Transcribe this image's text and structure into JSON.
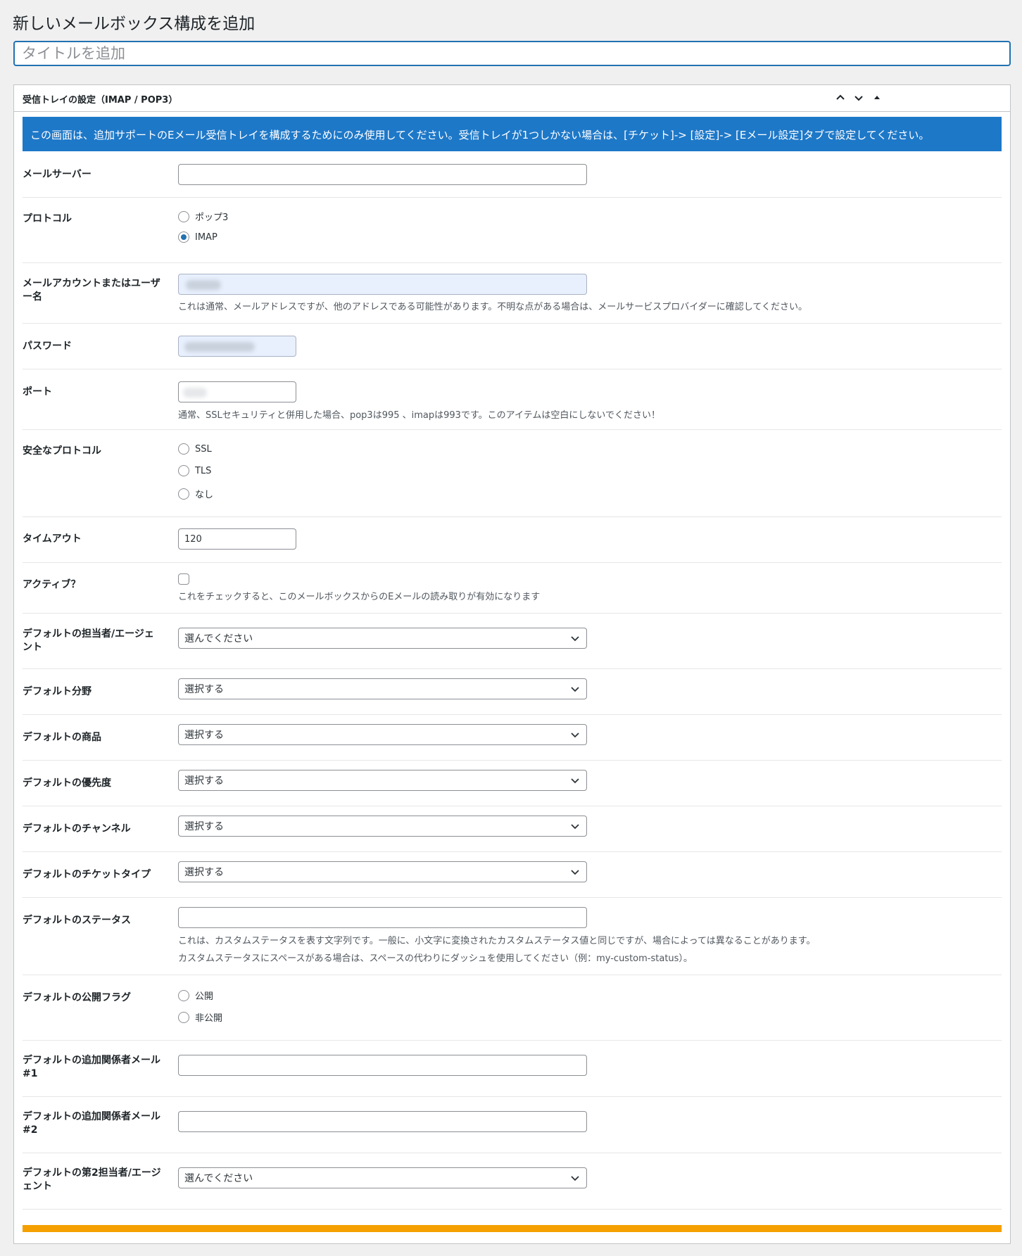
{
  "page": {
    "title": "新しいメールボックス構成を追加",
    "title_input_placeholder": "タイトルを追加"
  },
  "postbox": {
    "title": "受信トレイの設定（IMAP / POP3）",
    "notice": "この画面は、追加サポートのEメール受信トレイを構成するためにのみ使用してください。受信トレイが1つしかない場合は、[チケット]-> [設定]-> [Eメール設定]タブで設定してください。"
  },
  "fields": {
    "mail_server": {
      "label": "メールサーバー",
      "value": ""
    },
    "protocol": {
      "label": "プロトコル",
      "options": [
        "ポップ3",
        "IMAP"
      ],
      "selected": "IMAP"
    },
    "account": {
      "label": "メールアカウントまたはユーザー名",
      "description": "これは通常、メールアドレスですが、他のアドレスである可能性があります。不明な点がある場合は、メールサービスプロバイダーに確認してください。"
    },
    "password": {
      "label": "パスワード"
    },
    "port": {
      "label": "ポート",
      "description": "通常、SSLセキュリティと併用した場合、pop3は995 、imapは993です。このアイテムは空白にしないでください！"
    },
    "secure_protocol": {
      "label": "安全なプロトコル",
      "options": [
        "SSL",
        "TLS",
        "なし"
      ]
    },
    "timeout": {
      "label": "タイムアウト",
      "value": "120"
    },
    "active": {
      "label": "アクティブ？",
      "checked": false,
      "description": "これをチェックすると、このメールボックスからのEメールの読み取りが有効になります"
    },
    "default_agent": {
      "label": "デフォルトの担当者/エージェント",
      "selected": "選んでください"
    },
    "default_category": {
      "label": "デフォルト分野",
      "selected": "選択する"
    },
    "default_product": {
      "label": "デフォルトの商品",
      "selected": "選択する"
    },
    "default_priority": {
      "label": "デフォルトの優先度",
      "selected": "選択する"
    },
    "default_channel": {
      "label": "デフォルトのチャンネル",
      "selected": "選択する"
    },
    "default_ticket_type": {
      "label": "デフォルトのチケットタイプ",
      "selected": "選択する"
    },
    "default_status": {
      "label": "デフォルトのステータス",
      "value": "",
      "description_1": "これは、カスタムステータスを表す文字列です。一般に、小文字に変換されたカスタムステータス値と同じですが、場合によっては異なることがあります。",
      "description_2": "カスタムステータスにスペースがある場合は、スペースの代わりにダッシュを使用してください（例：my-custom-status）。"
    },
    "default_public_flag": {
      "label": "デフォルトの公開フラグ",
      "options": [
        "公開",
        "非公開"
      ]
    },
    "default_cc_1": {
      "label": "デフォルトの追加関係者メール#1",
      "value": ""
    },
    "default_cc_2": {
      "label": "デフォルトの追加関係者メール#2",
      "value": ""
    },
    "default_second_agent": {
      "label": "デフォルトの第2担当者/エージェント",
      "selected": "選んでください"
    }
  },
  "colors": {
    "notice_bg": "#1e78c8",
    "focus_border": "#2271b1",
    "bottom_bar": "#f5a000"
  },
  "icons": {
    "move_up": "chevron-up-icon",
    "move_down": "chevron-down-icon",
    "toggle": "triangle-up-icon",
    "select_arrow": "chevron-down-icon"
  }
}
